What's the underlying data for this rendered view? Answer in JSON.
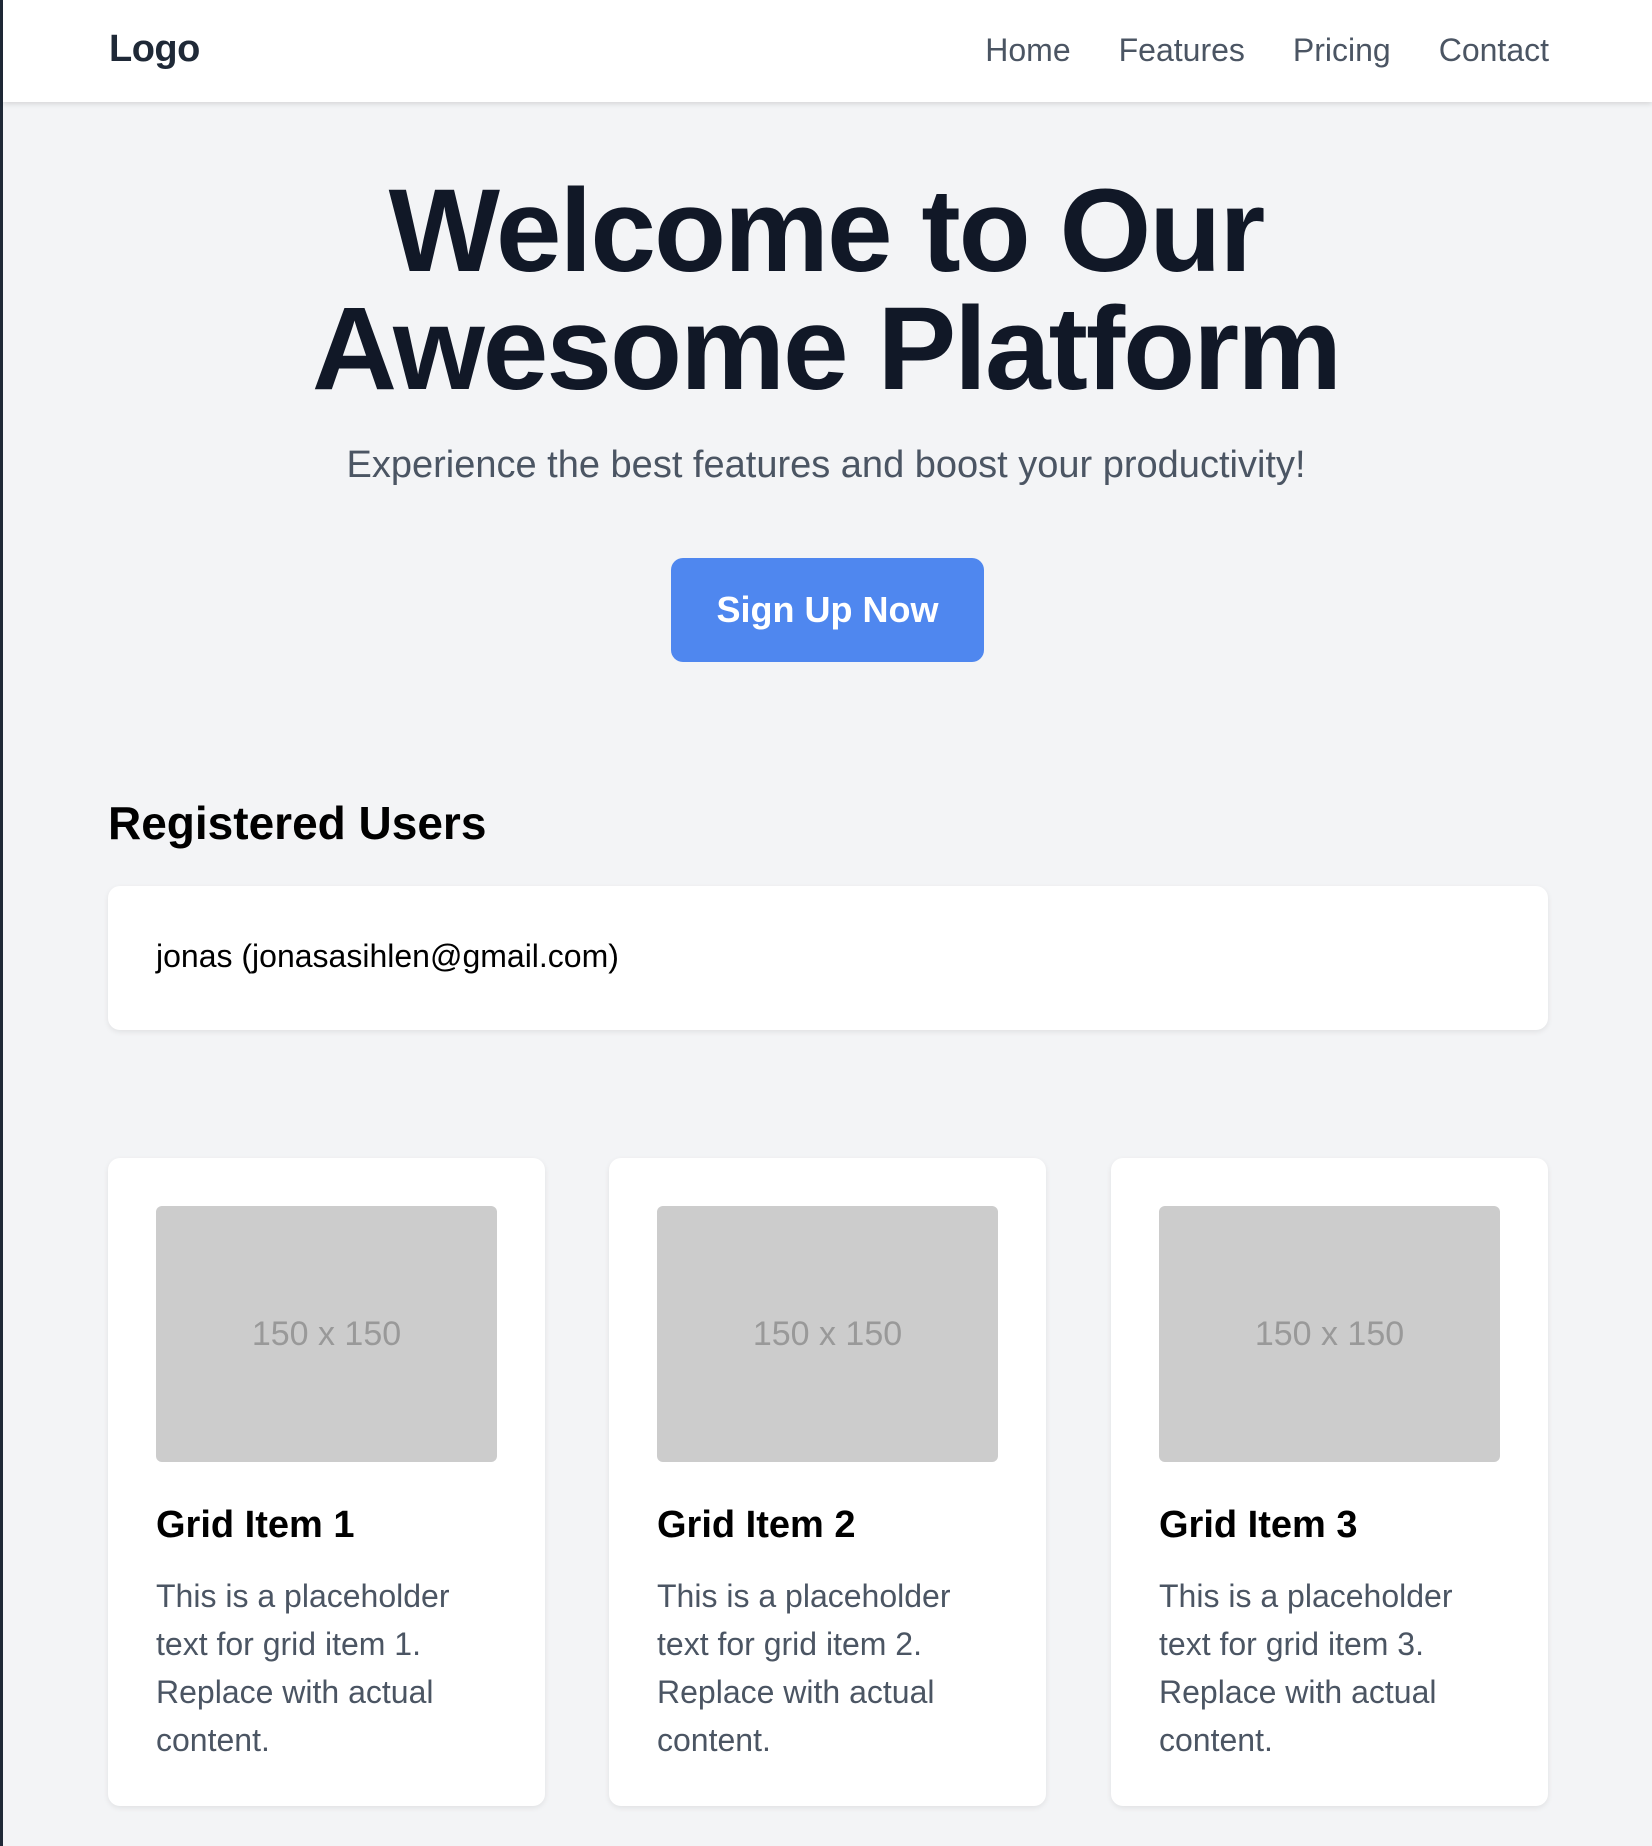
{
  "nav": {
    "logo": "Logo",
    "links": [
      "Home",
      "Features",
      "Pricing",
      "Contact"
    ]
  },
  "hero": {
    "title_line1": "Welcome to Our",
    "title_line2": "Awesome Platform",
    "subtitle": "Experience the best features and boost your productivity!",
    "cta_label": "Sign Up Now"
  },
  "users": {
    "heading": "Registered Users",
    "entries": [
      "jonas (jonasasihlen@gmail.com)"
    ]
  },
  "grid": {
    "items": [
      {
        "image_label": "150 x 150",
        "title": "Grid Item 1",
        "text": "This is a placeholder text for grid item 1. Replace with actual content."
      },
      {
        "image_label": "150 x 150",
        "title": "Grid Item 2",
        "text": "This is a placeholder text for grid item 2. Replace with actual content."
      },
      {
        "image_label": "150 x 150",
        "title": "Grid Item 3",
        "text": "This is a placeholder text for grid item 3. Replace with actual content."
      }
    ]
  },
  "colors": {
    "page_bg": "#f3f4f6",
    "accent": "#4f87ef",
    "heading": "#111827",
    "muted_text": "#4b5563",
    "placeholder_bg": "#cccccc"
  }
}
